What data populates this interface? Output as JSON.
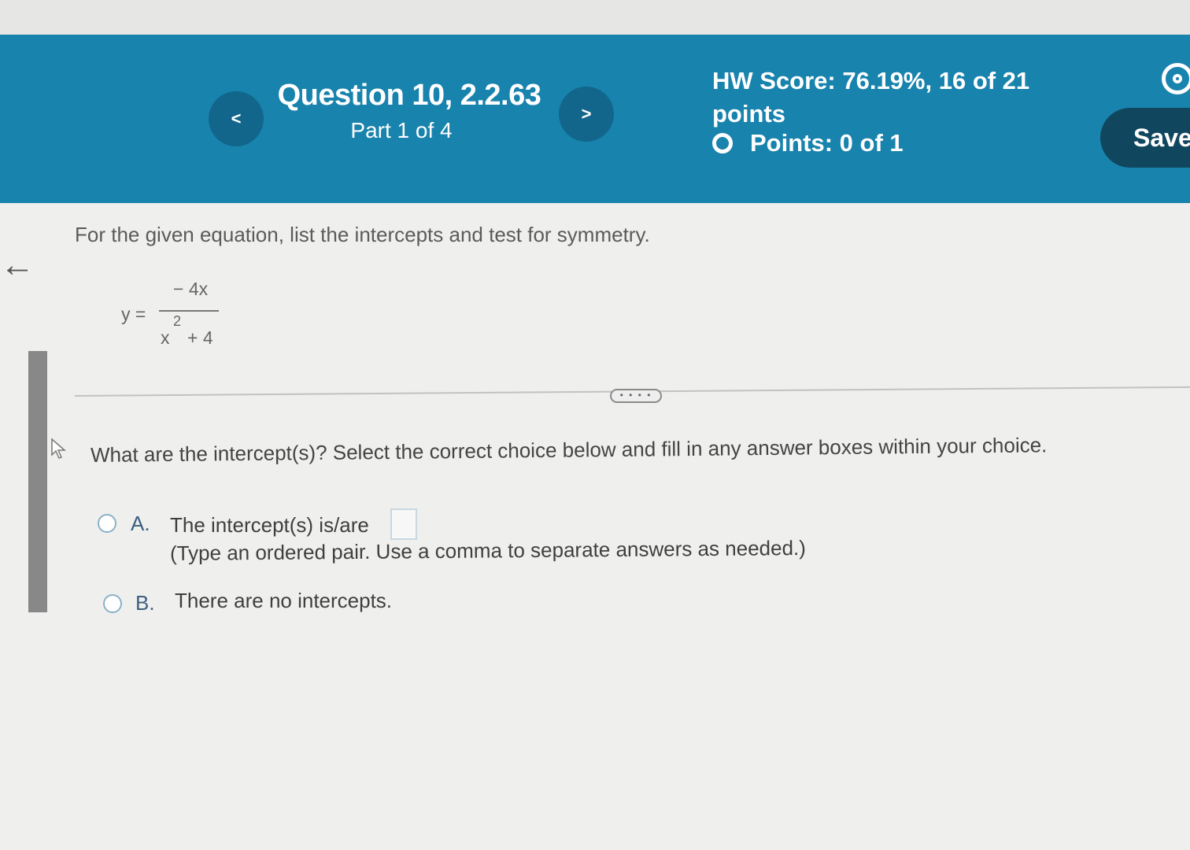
{
  "header": {
    "question_title": "Question 10, 2.2.63",
    "part": "Part 1 of 4",
    "hw_score_line1": "HW Score: 76.19%, 16 of 21",
    "hw_score_line2": "points",
    "points": "Points: 0 of 1",
    "save_label": "Save",
    "prev_label": "<",
    "next_label": ">"
  },
  "problem": {
    "prompt": "For the given equation, list the intercepts and test for symmetry.",
    "equation": {
      "lhs": "y =",
      "numerator": "− 4x",
      "denominator_base": "x",
      "denominator_exponent": "2",
      "denominator_rest": "+ 4"
    },
    "more_label": "• • • •"
  },
  "part_question": {
    "text": "What are the intercept(s)? Select the correct choice below and fill in any answer boxes within your choice.",
    "options": [
      {
        "letter": "A.",
        "text": "The intercept(s) is/are",
        "hint": "(Type an ordered pair. Use a comma to separate answers as needed.)",
        "answer_value": ""
      },
      {
        "letter": "B.",
        "text": "There are no intercepts."
      }
    ]
  },
  "colors": {
    "header_bg": "#1883ad",
    "nav_button": "#12668c",
    "save_button": "#10475f"
  }
}
